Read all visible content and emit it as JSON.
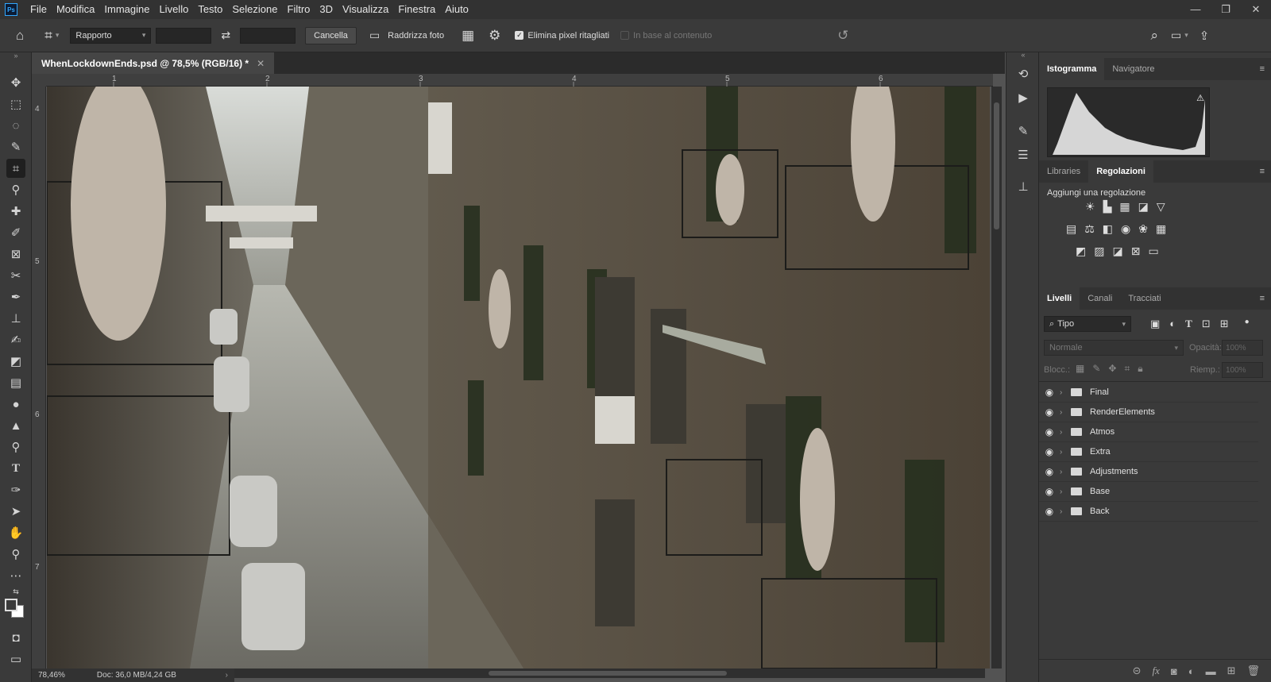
{
  "app": {
    "logo": "Ps"
  },
  "menu": [
    "File",
    "Modifica",
    "Immagine",
    "Livello",
    "Testo",
    "Selezione",
    "Filtro",
    "3D",
    "Visualizza",
    "Finestra",
    "Aiuto"
  ],
  "window_controls": {
    "minimize": "—",
    "restore": "❐",
    "close": "✕"
  },
  "options": {
    "ratio_select": "Rapporto",
    "cancel_label": "Cancella",
    "straighten_label": "Raddrizza foto",
    "delete_pixels_label": "Elimina pixel ritagliati",
    "content_aware_label": "In base al contenuto"
  },
  "document": {
    "tab_title": "WhenLockdownEnds.psd @ 78,5% (RGB/16) *"
  },
  "status": {
    "zoom": "78,46%",
    "doc_info": "Doc: 36,0 MB/4,24 GB"
  },
  "ruler": {
    "h_ticks": [
      "1",
      "2",
      "3",
      "4",
      "5",
      "6"
    ],
    "v_ticks": [
      "4",
      "5",
      "6",
      "7"
    ]
  },
  "panels": {
    "top_tabs": [
      "Istogramma",
      "Navigatore"
    ],
    "mid_tabs": [
      "Libraries",
      "Regolazioni"
    ],
    "add_adjustment": "Aggiungi una regolazione",
    "layers_tabs": [
      "Livelli",
      "Canali",
      "Tracciati"
    ],
    "filter_type": "Tipo",
    "blend_mode": "Normale",
    "opacity_label": "Opacità:",
    "opacity_value": "100%",
    "lock_label": "Blocc.:",
    "fill_label": "Riemp.:",
    "fill_value": "100%"
  },
  "layers": [
    "Final",
    "RenderElements",
    "Atmos",
    "Extra",
    "Adjustments",
    "Base",
    "Back"
  ],
  "colors": {
    "ui_dark": "#323232",
    "ui_mid": "#3a3a3a",
    "accent": "#31a8ff"
  }
}
